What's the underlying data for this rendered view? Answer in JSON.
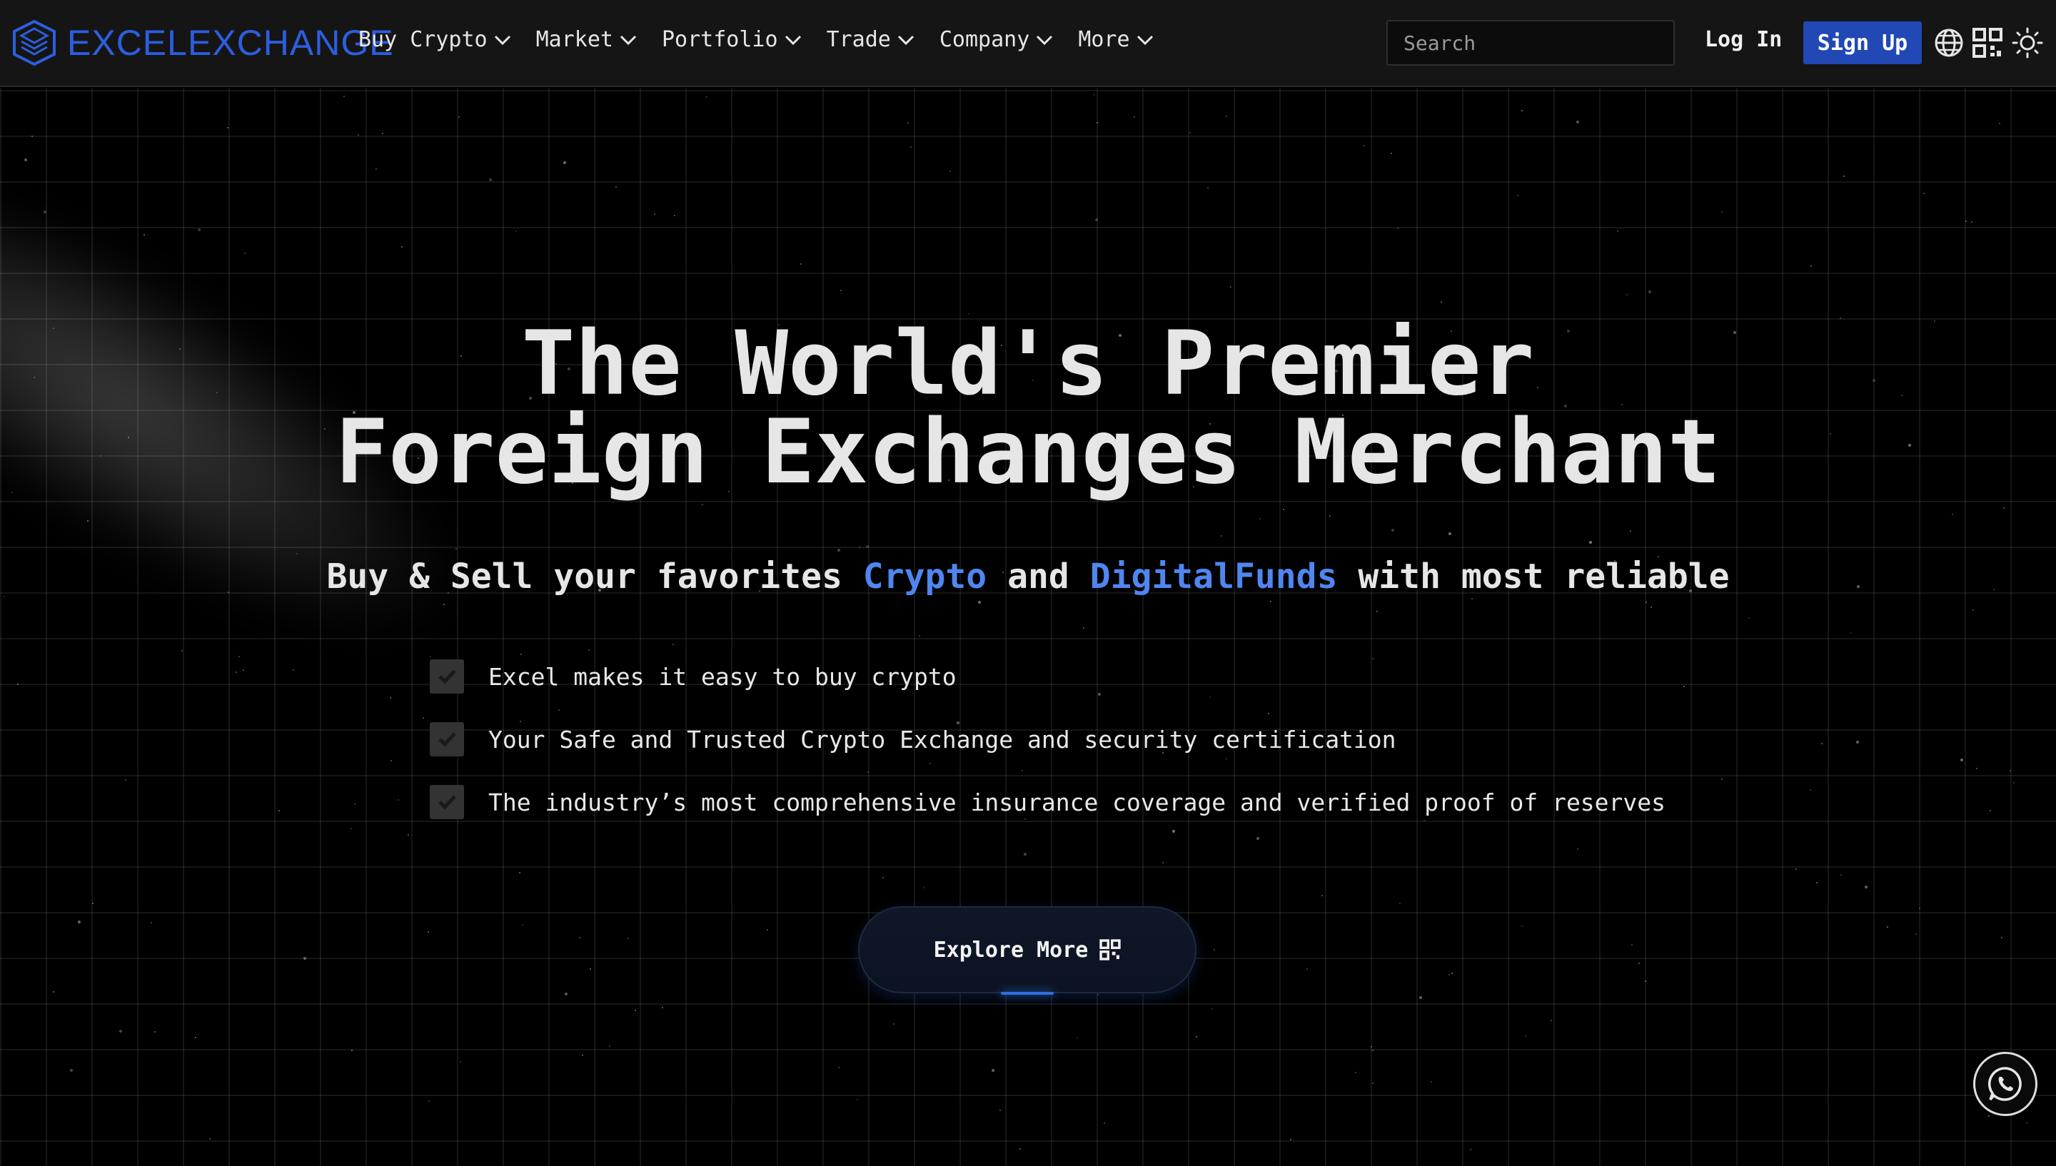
{
  "brand": {
    "name": "EXCELEXCHANGE",
    "color": "#2c5ee0"
  },
  "nav": {
    "items": [
      {
        "label": "Buy Crypto"
      },
      {
        "label": "Market"
      },
      {
        "label": "Portfolio"
      },
      {
        "label": "Trade"
      },
      {
        "label": "Company"
      },
      {
        "label": "More"
      }
    ],
    "search_placeholder": "Search",
    "login_label": "Log In",
    "signup_label": "Sign Up",
    "icons": [
      "globe-icon",
      "qr-code-icon",
      "sun-icon"
    ]
  },
  "hero": {
    "headline_line1": "The World's Premier",
    "headline_line2": "Foreign Exchanges Merchant",
    "subline_part1": "Buy & Sell your favorites ",
    "subline_accent1": "Crypto",
    "subline_part2": " and ",
    "subline_accent2": "DigitalFunds",
    "subline_part3": " with most reliable",
    "features": [
      "Excel makes it easy to buy crypto",
      "Your Safe and Trusted Crypto Exchange and security certification",
      "The industry’s most comprehensive insurance coverage and verified proof of reserves"
    ],
    "cta_label": "Explore More"
  },
  "colors": {
    "accent": "#4f86f0",
    "signup_bg": "#2148b4"
  },
  "floating": {
    "chat_icon": "whatsapp-icon"
  }
}
